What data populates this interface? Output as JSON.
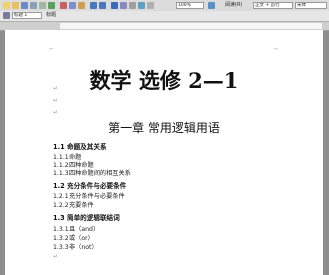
{
  "toolbar": {
    "zoom": "100%",
    "reading_mode": "阅读(R)",
    "style_box": "正文 + 首行",
    "font_box": "宋体",
    "left_box": "标题 1",
    "tab_label": "标题"
  },
  "document": {
    "title": "数学  选修 2—1",
    "chapter": "第一章  常用逻辑用语",
    "sections": [
      {
        "heading": "1.1  命题及其关系",
        "items": [
          {
            "num": "1.1.1",
            "text": "命题"
          },
          {
            "num": "1.1.2",
            "text": "四种命题"
          },
          {
            "num": "1.1.3",
            "text": "四种命题间的相互关系"
          }
        ]
      },
      {
        "heading": "1.2  充分条件与必要条件",
        "items": [
          {
            "num": "1.2.1",
            "text": "充分条件与必要条件"
          },
          {
            "num": "1.2.2",
            "text": "充要条件"
          }
        ]
      },
      {
        "heading": "1.3  简单的逻辑联结词",
        "items": [
          {
            "num": "1.3.1",
            "text": "且（and）"
          },
          {
            "num": "1.3.2",
            "text": "或（or）"
          },
          {
            "num": "1.3.3",
            "text": "非（not）"
          }
        ]
      }
    ]
  },
  "colors": {
    "page_bg": "#ffffff",
    "workspace_bg": "#8e8e8e",
    "toolbar_bg": "#dcdcdc"
  }
}
